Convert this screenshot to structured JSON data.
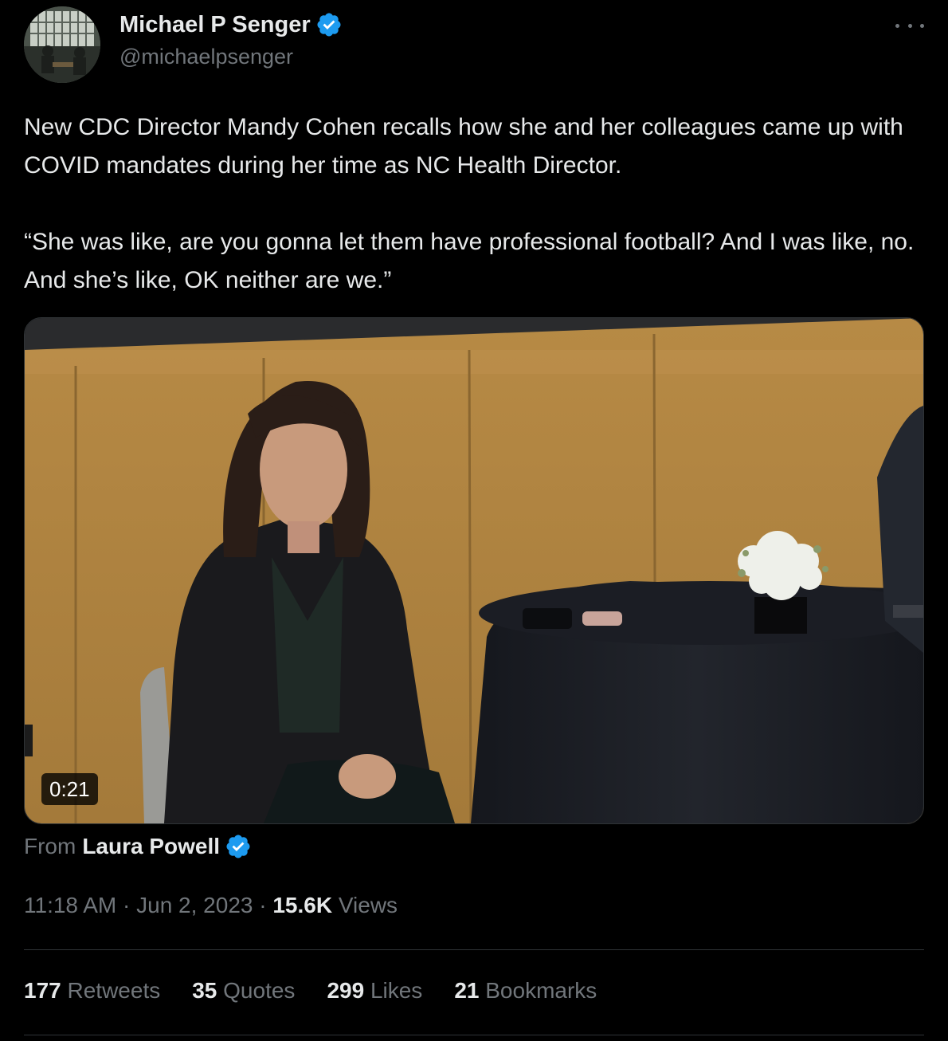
{
  "author": {
    "name": "Michael P Senger",
    "handle": "@michaelpsenger"
  },
  "tweet": {
    "paragraph1": "New CDC Director Mandy Cohen recalls how she and her colleagues came up with COVID mandates during her time as NC Health Director.",
    "paragraph2": "“She was like, are you gonna let them have professional football? And I was like, no. And she’s like, OK neither are we.”"
  },
  "media": {
    "duration": "0:21"
  },
  "source": {
    "prefix": "From",
    "name": "Laura Powell"
  },
  "meta": {
    "time": "11:18 AM",
    "sep1": "·",
    "date": "Jun 2, 2023",
    "sep2": "·",
    "views_count": "15.6K",
    "views_label": "Views"
  },
  "stats": {
    "retweets_count": "177",
    "retweets_label": "Retweets",
    "quotes_count": "35",
    "quotes_label": "Quotes",
    "likes_count": "299",
    "likes_label": "Likes",
    "bookmarks_count": "21",
    "bookmarks_label": "Bookmarks"
  },
  "colors": {
    "background": "#000000",
    "text": "#e7e9ea",
    "secondary": "#71767b",
    "verified": "#1d9bf0",
    "divider": "#2f3336"
  },
  "icons": {
    "verified": "verified-badge-icon",
    "more": "more-options-icon"
  }
}
